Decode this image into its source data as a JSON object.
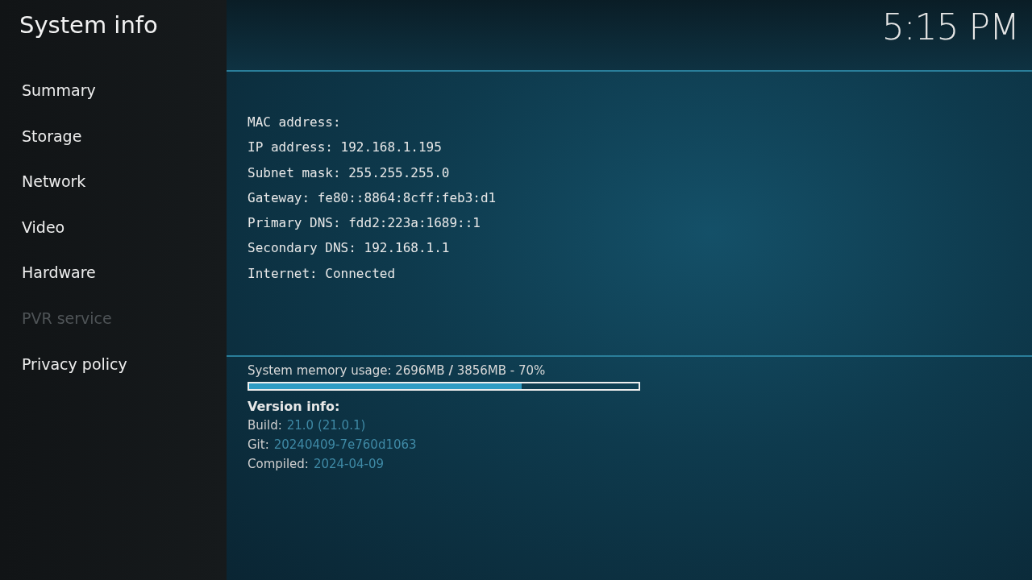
{
  "header": {
    "title": "System info",
    "clock": "5:15 PM"
  },
  "sidebar": {
    "items": [
      {
        "label": "Summary",
        "disabled": false
      },
      {
        "label": "Storage",
        "disabled": false
      },
      {
        "label": "Network",
        "disabled": false
      },
      {
        "label": "Video",
        "disabled": false
      },
      {
        "label": "Hardware",
        "disabled": false
      },
      {
        "label": "PVR service",
        "disabled": true
      },
      {
        "label": "Privacy policy",
        "disabled": false
      }
    ]
  },
  "network_info": [
    "MAC address:",
    "IP address: 192.168.1.195",
    "Subnet mask: 255.255.255.0",
    "Gateway: fe80::8864:8cff:feb3:d1",
    "Primary DNS: fdd2:223a:1689::1",
    "Secondary DNS: 192.168.1.1",
    "Internet: Connected"
  ],
  "memory": {
    "text": "System memory usage: 2696MB **/** 3856MB - 70%",
    "level": 0.7
  },
  "version": {
    "heading": "Version info:",
    "rows": [
      {
        "label": "Build:",
        "value": "21.0 (21.0.1)"
      },
      {
        "label": "Git:",
        "value": "20240409-7e760d1063"
      },
      {
        "label": "Compiled:",
        "value": "2024-04-09"
      }
    ]
  }
}
